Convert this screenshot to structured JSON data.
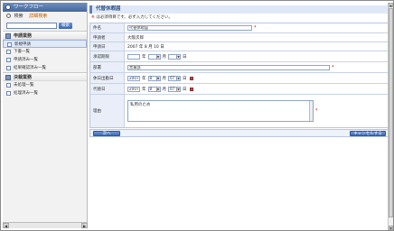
{
  "sidebar": {
    "title": "ワークフロー",
    "search_link": "検索",
    "advanced_link": "詳細検索",
    "search_button": "検索",
    "sections": [
      {
        "label": "申請業務",
        "items": [
          "新規申請",
          "下書一覧",
          "申請済み一覧",
          "結果確認済み一覧"
        ]
      },
      {
        "label": "決裁業務",
        "items": [
          "未処理一覧",
          "処理済み一覧"
        ]
      }
    ],
    "scroll_left": "◀",
    "scroll_right": "▶"
  },
  "main": {
    "title": "代替休暇届",
    "note_star": "※",
    "note_text": "は必須項目です。必ず入力してください。",
    "form": {
      "subject_label": "件名",
      "subject_value": "代替休暇届",
      "applicant_label": "申請者",
      "applicant_value": "大阪次郎",
      "apply_date_label": "申請日",
      "apply_date_value": "2007 年 8 月 10 日",
      "settle_date_label": "承認期限",
      "settle_year_unit": "年",
      "settle_month_unit": "月",
      "settle_day_unit": "日",
      "dept_label": "部署",
      "dept_value": "営業部",
      "work_date_label": "休日出勤日",
      "work_year": "2007",
      "work_month": "8",
      "work_day": "07",
      "alt_date_label": "代替日",
      "alt_year": "2007",
      "alt_month": "8",
      "alt_day": "07",
      "year_unit": "年",
      "month_unit": "月",
      "day_unit": "日",
      "reason_label": "理由",
      "reason_value": "私用のため",
      "required_mark": "*"
    },
    "next_button": "次へ",
    "cancel_button": "キャンセルする"
  }
}
